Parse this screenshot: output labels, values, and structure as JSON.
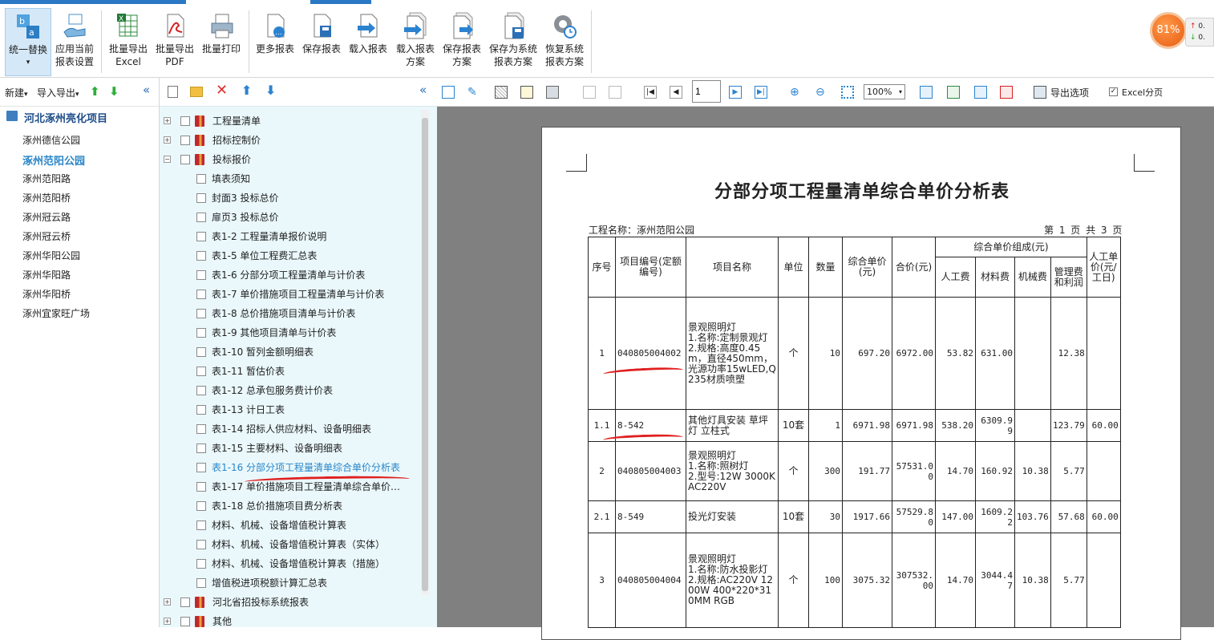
{
  "ribbon": {
    "buttons": [
      {
        "label": "统一替换",
        "label2": "▾"
      },
      {
        "label": "应用当前",
        "label2": "报表设置"
      },
      {
        "label": "批量导出",
        "label2": "Excel"
      },
      {
        "label": "批量导出",
        "label2": "PDF"
      },
      {
        "label": "批量打印",
        "label2": ""
      },
      {
        "label": "更多报表",
        "label2": ""
      },
      {
        "label": "保存报表",
        "label2": ""
      },
      {
        "label": "载入报表",
        "label2": ""
      },
      {
        "label": "载入报表",
        "label2": "方案"
      },
      {
        "label": "保存报表",
        "label2": "方案"
      },
      {
        "label": "保存为系统",
        "label2": "报表方案"
      },
      {
        "label": "恢复系统",
        "label2": "报表方案"
      }
    ]
  },
  "monitor": {
    "cpu": "81%",
    "up": "0.",
    "down": "0."
  },
  "left": {
    "new_label": "新建",
    "import_label": "导入导出",
    "project": "河北涿州亮化项目",
    "items": [
      "涿州德信公园",
      "涿州范阳公园",
      "涿州范阳路",
      "涿州范阳桥",
      "涿州冠云路",
      "涿州冠云桥",
      "涿州华阳公园",
      "涿州华阳路",
      "涿州华阳桥",
      "涿州宜家旺广场"
    ]
  },
  "tree": {
    "groups": [
      "工程量清单",
      "招标控制价",
      "投标报价"
    ],
    "children": [
      "填表须知",
      "封面3 投标总价",
      "扉页3 投标总价",
      "表1-2 工程量清单报价说明",
      "表1-5 单位工程费汇总表",
      "表1-6 分部分项工程量清单与计价表",
      "表1-7 单价措施项目工程量清单与计价表",
      "表1-8 总价措施项目清单与计价表",
      "表1-9 其他项目清单与计价表",
      "表1-10 暂列金额明细表",
      "表1-11 暂估价表",
      "表1-12 总承包服务费计价表",
      "表1-13 计日工表",
      "表1-14 招标人供应材料、设备明细表",
      "表1-15 主要材料、设备明细表",
      "表1-16 分部分项工程量清单综合单价分析表",
      "表1-17 单价措施项目工程量清单综合单价…",
      "表1-18 总价措施项目费分析表",
      "材料、机械、设备增值税计算表",
      "材料、机械、设备增值税计算表（实体）",
      "材料、机械、设备增值税计算表（措施）",
      "增值税进项税额计算汇总表"
    ],
    "tail": [
      "河北省招投标系统报表",
      "其他"
    ]
  },
  "viewer": {
    "page_input": "1",
    "zoom": "100%",
    "export_label": "导出选项",
    "excel_split_label": "Excel分页"
  },
  "report": {
    "title": "分部分项工程量清单综合单价分析表",
    "project_name": "工程名称：涿州范阳公园",
    "page_info": "第 1 页  共 3 页",
    "headers": {
      "seq": "序号",
      "code": "项目编号(定额编号)",
      "name": "项目名称",
      "unit": "单位",
      "qty": "数量",
      "unit_price": "综合单价(元)",
      "total": "合价(元)",
      "composition": "综合单价组成(元)",
      "labor": "人工费",
      "material": "材料费",
      "machine": "机械费",
      "mgmt": "管理费和利润",
      "wage": "人工单价(元/工日)"
    },
    "rows": [
      {
        "seq": "1",
        "code": "040805004002",
        "name": "景观照明灯\n1.名称:定制景观灯\n2.规格:高度0.45m，直径450mm，光源功率15wLED,Q235材质喷塑",
        "unit": "个",
        "qty": "10",
        "unit_price": "697.20",
        "total": "6972.00",
        "labor": "53.82",
        "material": "631.00",
        "machine": "",
        "mgmt": "12.38",
        "wage": ""
      },
      {
        "seq": "1.1",
        "code": "8-542",
        "name": "其他灯具安装 草坪灯 立柱式",
        "unit": "10套",
        "qty": "1",
        "unit_price": "6971.98",
        "total": "6971.98",
        "labor": "538.20",
        "material": "6309.99",
        "machine": "",
        "mgmt": "123.79",
        "wage": "60.00"
      },
      {
        "seq": "2",
        "code": "040805004003",
        "name": "景观照明灯\n1.名称:照树灯\n2.型号:12W 3000K AC220V",
        "unit": "个",
        "qty": "300",
        "unit_price": "191.77",
        "total": "57531.00",
        "labor": "14.70",
        "material": "160.92",
        "machine": "10.38",
        "mgmt": "5.77",
        "wage": ""
      },
      {
        "seq": "2.1",
        "code": "8-549",
        "name": "投光灯安装",
        "unit": "10套",
        "qty": "30",
        "unit_price": "1917.66",
        "total": "57529.80",
        "labor": "147.00",
        "material": "1609.22",
        "machine": "103.76",
        "mgmt": "57.68",
        "wage": "60.00"
      },
      {
        "seq": "3",
        "code": "040805004004",
        "name": "景观照明灯\n1.名称:防水投影灯\n2.规格:AC220V 1200W 400*220*310MM RGB",
        "unit": "个",
        "qty": "100",
        "unit_price": "3075.32",
        "total": "307532.00",
        "labor": "14.70",
        "material": "3044.47",
        "machine": "10.38",
        "mgmt": "5.77",
        "wage": ""
      }
    ]
  }
}
